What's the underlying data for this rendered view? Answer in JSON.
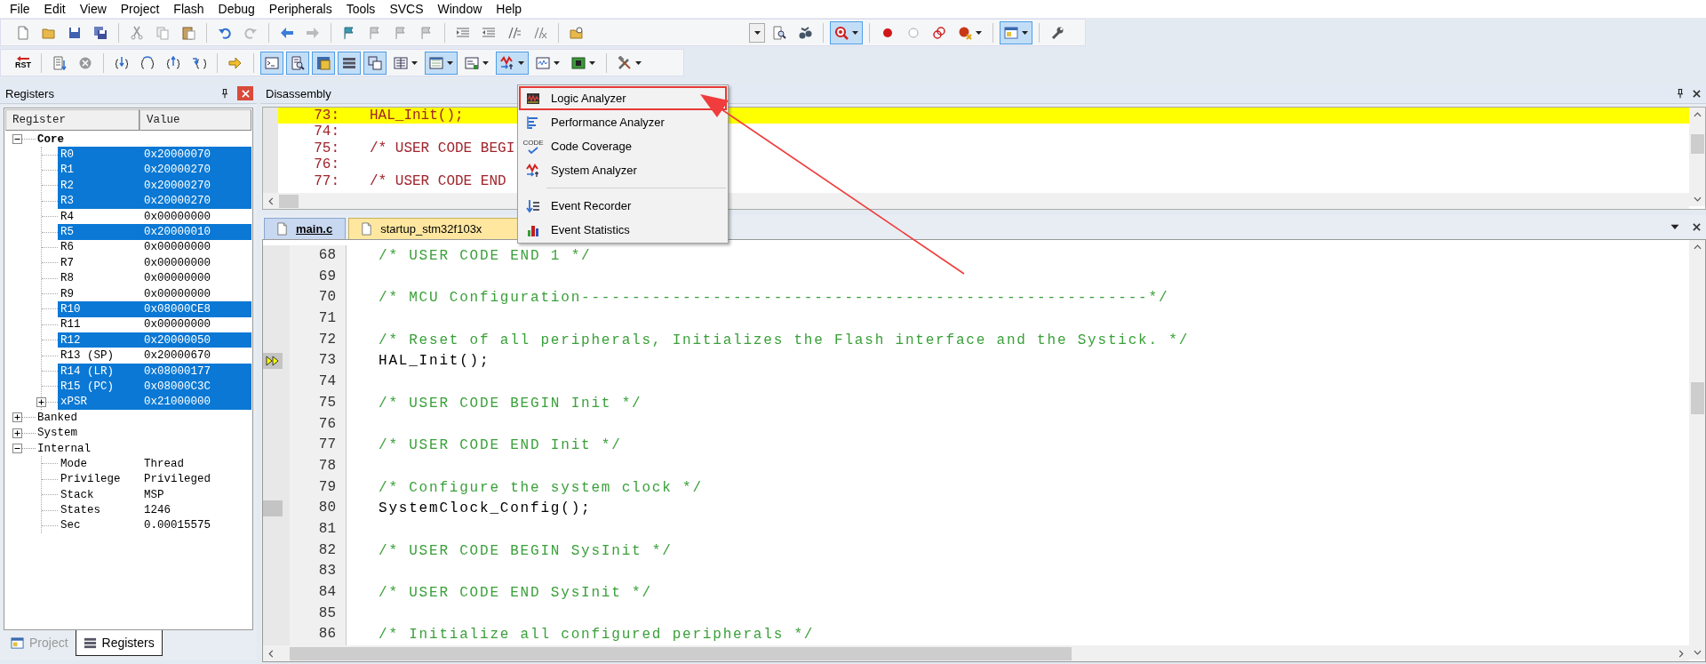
{
  "menu_bar": [
    "File",
    "Edit",
    "View",
    "Project",
    "Flash",
    "Debug",
    "Peripherals",
    "Tools",
    "SVCS",
    "Window",
    "Help"
  ],
  "toolbars": [
    {
      "items": [
        {
          "kind": "new",
          "pressed": false,
          "dropdown": false
        },
        {
          "kind": "open",
          "pressed": false,
          "dropdown": false
        },
        {
          "kind": "save",
          "pressed": false,
          "dropdown": false
        },
        {
          "kind": "saveall",
          "pressed": false,
          "dropdown": false
        },
        {
          "kind": "separator"
        },
        {
          "kind": "cut",
          "pressed": false,
          "dropdown": false
        },
        {
          "kind": "copy",
          "pressed": false,
          "dropdown": false
        },
        {
          "kind": "paste",
          "pressed": false,
          "dropdown": false
        },
        {
          "kind": "separator"
        },
        {
          "kind": "undo",
          "pressed": false,
          "dropdown": false
        },
        {
          "kind": "redo",
          "pressed": false,
          "dropdown": false
        },
        {
          "kind": "separator"
        },
        {
          "kind": "back",
          "pressed": false,
          "dropdown": false
        },
        {
          "kind": "forward",
          "pressed": false,
          "dropdown": false
        },
        {
          "kind": "separator"
        },
        {
          "kind": "flag",
          "pressed": false,
          "dropdown": false
        },
        {
          "kind": "flaggrey",
          "pressed": false,
          "dropdown": false
        },
        {
          "kind": "flaggrey",
          "pressed": false,
          "dropdown": false
        },
        {
          "kind": "flaggrey",
          "pressed": false,
          "dropdown": false
        },
        {
          "kind": "separator"
        },
        {
          "kind": "indent",
          "pressed": false,
          "dropdown": false
        },
        {
          "kind": "outdent",
          "pressed": false,
          "dropdown": false
        },
        {
          "kind": "comment",
          "pressed": false,
          "dropdown": false
        },
        {
          "kind": "uncomment",
          "pressed": false,
          "dropdown": false
        },
        {
          "kind": "separator"
        },
        {
          "kind": "findfolder",
          "pressed": false,
          "dropdown": false
        },
        {
          "kind": "combo",
          "pressed": false,
          "dropdown": true
        },
        {
          "kind": "finddoc",
          "pressed": false,
          "dropdown": false
        },
        {
          "kind": "bino",
          "pressed": false,
          "dropdown": false
        },
        {
          "kind": "separator"
        },
        {
          "kind": "debug",
          "pressed": true,
          "dropdown": true
        },
        {
          "kind": "separator"
        },
        {
          "kind": "bp",
          "pressed": false,
          "dropdown": false
        },
        {
          "kind": "bphollow",
          "pressed": false,
          "dropdown": false
        },
        {
          "kind": "bpdisable",
          "pressed": false,
          "dropdown": false
        },
        {
          "kind": "bpkill",
          "pressed": false,
          "dropdown": true
        },
        {
          "kind": "separator"
        },
        {
          "kind": "window",
          "pressed": true,
          "dropdown": true
        },
        {
          "kind": "separator"
        },
        {
          "kind": "wrench",
          "pressed": false,
          "dropdown": false
        }
      ]
    },
    {
      "items": [
        {
          "kind": "reset",
          "label": "RST",
          "pressed": false,
          "dropdown": false
        },
        {
          "kind": "separator"
        },
        {
          "kind": "regdoc",
          "pressed": false,
          "dropdown": false
        },
        {
          "kind": "stop",
          "pressed": false,
          "dropdown": false
        },
        {
          "kind": "separator"
        },
        {
          "kind": "stepin",
          "pressed": false,
          "dropdown": false
        },
        {
          "kind": "stepover",
          "pressed": false,
          "dropdown": false
        },
        {
          "kind": "stepout",
          "pressed": false,
          "dropdown": false
        },
        {
          "kind": "runto",
          "pressed": false,
          "dropdown": false
        },
        {
          "kind": "separator"
        },
        {
          "kind": "runarrow",
          "pressed": false,
          "dropdown": false
        },
        {
          "kind": "separator"
        },
        {
          "kind": "cmdwin",
          "pressed": true,
          "dropdown": false
        },
        {
          "kind": "disasm",
          "pressed": true,
          "dropdown": false
        },
        {
          "kind": "symbols",
          "pressed": true,
          "dropdown": false
        },
        {
          "kind": "registers",
          "pressed": true,
          "dropdown": false
        },
        {
          "kind": "callstack",
          "pressed": true,
          "dropdown": false
        },
        {
          "kind": "watch",
          "pressed": false,
          "dropdown": true
        },
        {
          "kind": "memory",
          "pressed": true,
          "dropdown": true
        },
        {
          "kind": "serial",
          "pressed": false,
          "dropdown": true
        },
        {
          "kind": "sysanalyzer",
          "pressed": true,
          "dropdown": true
        },
        {
          "kind": "trace",
          "pressed": false,
          "dropdown": true
        },
        {
          "kind": "toolbox",
          "pressed": false,
          "dropdown": true
        },
        {
          "kind": "separator"
        },
        {
          "kind": "tools",
          "pressed": false,
          "dropdown": true
        }
      ]
    }
  ],
  "registers": {
    "title": "Registers",
    "columns": [
      "Register",
      "Value"
    ],
    "groups": [
      {
        "label": "Core",
        "expanded": true,
        "children": [
          {
            "name": "R0",
            "value": "0x20000070",
            "selected": true
          },
          {
            "name": "R1",
            "value": "0x20000270",
            "selected": true
          },
          {
            "name": "R2",
            "value": "0x20000270",
            "selected": true
          },
          {
            "name": "R3",
            "value": "0x20000270",
            "selected": true
          },
          {
            "name": "R4",
            "value": "0x00000000",
            "selected": false
          },
          {
            "name": "R5",
            "value": "0x20000010",
            "selected": true
          },
          {
            "name": "R6",
            "value": "0x00000000",
            "selected": false
          },
          {
            "name": "R7",
            "value": "0x00000000",
            "selected": false
          },
          {
            "name": "R8",
            "value": "0x00000000",
            "selected": false
          },
          {
            "name": "R9",
            "value": "0x00000000",
            "selected": false
          },
          {
            "name": "R10",
            "value": "0x08000CE8",
            "selected": true
          },
          {
            "name": "R11",
            "value": "0x00000000",
            "selected": false
          },
          {
            "name": "R12",
            "value": "0x20000050",
            "selected": true
          },
          {
            "name": "R13 (SP)",
            "value": "0x20000670",
            "selected": false
          },
          {
            "name": "R14 (LR)",
            "value": "0x08000177",
            "selected": true
          },
          {
            "name": "R15 (PC)",
            "value": "0x08000C3C",
            "selected": true
          },
          {
            "name": "xPSR",
            "value": "0x21000000",
            "selected": true,
            "expanded": false
          }
        ]
      },
      {
        "label": "Banked",
        "expanded": false
      },
      {
        "label": "System",
        "expanded": false
      },
      {
        "label": "Internal",
        "expanded": true,
        "children": [
          {
            "name": "Mode",
            "value": "Thread",
            "selected": false
          },
          {
            "name": "Privilege",
            "value": "Privileged",
            "selected": false
          },
          {
            "name": "Stack",
            "value": "MSP",
            "selected": false
          },
          {
            "name": "States",
            "value": "1246",
            "selected": false
          },
          {
            "name": "Sec",
            "value": "0.00015575",
            "selected": false
          }
        ]
      }
    ]
  },
  "bottom_tabs": [
    {
      "label": "Project",
      "selected": false
    },
    {
      "label": "Registers",
      "selected": true
    }
  ],
  "disassembly": {
    "title": "Disassembly",
    "lines": [
      {
        "address": "73:",
        "code": "HAL_Init();",
        "current": true
      },
      {
        "address": "74:",
        "current": false
      },
      {
        "address": "75:",
        "code": "/* USER CODE BEGI",
        "current": false
      },
      {
        "address": "76:",
        "current": false
      },
      {
        "address": "77:",
        "code": "/* USER CODE END",
        "current": false
      }
    ]
  },
  "editor": {
    "tabs": [
      {
        "label": "main.c",
        "selected": true
      },
      {
        "label": "startup_stm32f103x",
        "selected": false
      }
    ],
    "lines": [
      {
        "number": "68",
        "kind": "comment",
        "code": "/* USER CODE END 1 */",
        "executable": false,
        "current": false
      },
      {
        "number": "69",
        "kind": "blank",
        "executable": false,
        "current": false
      },
      {
        "number": "70",
        "kind": "comment",
        "code": "/* MCU Configuration--------------------------------------------------------*/",
        "executable": false,
        "current": false
      },
      {
        "number": "71",
        "kind": "blank",
        "executable": false,
        "current": false
      },
      {
        "number": "72",
        "kind": "comment",
        "code": "/* Reset of all peripherals, Initializes the Flash interface and the Systick. */",
        "executable": false,
        "current": false
      },
      {
        "number": "73",
        "kind": "code",
        "code": "HAL_Init();",
        "executable": true,
        "current": true
      },
      {
        "number": "74",
        "kind": "blank",
        "executable": false,
        "current": false
      },
      {
        "number": "75",
        "kind": "comment",
        "code": "/* USER CODE BEGIN Init */",
        "executable": false,
        "current": false
      },
      {
        "number": "76",
        "kind": "blank",
        "executable": false,
        "current": false
      },
      {
        "number": "77",
        "kind": "comment",
        "code": "/* USER CODE END Init */",
        "executable": false,
        "current": false
      },
      {
        "number": "78",
        "kind": "blank",
        "executable": false,
        "current": false
      },
      {
        "number": "79",
        "kind": "comment",
        "code": "/* Configure the system clock */",
        "executable": false,
        "current": false
      },
      {
        "number": "80",
        "kind": "code",
        "code": "SystemClock_Config();",
        "executable": true,
        "current": false
      },
      {
        "number": "81",
        "kind": "blank",
        "executable": false,
        "current": false
      },
      {
        "number": "82",
        "kind": "comment",
        "code": "/* USER CODE BEGIN SysInit */",
        "executable": false,
        "current": false
      },
      {
        "number": "83",
        "kind": "blank",
        "executable": false,
        "current": false
      },
      {
        "number": "84",
        "kind": "comment",
        "code": "/* USER CODE END SysInit */",
        "executable": false,
        "current": false
      },
      {
        "number": "85",
        "kind": "blank",
        "executable": false,
        "current": false
      },
      {
        "number": "86",
        "kind": "comment",
        "code": "/* Initialize all configured peripherals */",
        "executable": false,
        "current": false
      }
    ]
  },
  "analysis_menu": {
    "items": [
      {
        "kind": "logic",
        "label": "Logic Analyzer",
        "outlined": true
      },
      {
        "kind": "performance",
        "label": "Performance Analyzer",
        "outlined": false
      },
      {
        "kind": "coverage",
        "label": "Code Coverage",
        "icon_text": "CODE",
        "outlined": false
      },
      {
        "kind": "system",
        "label": "System Analyzer",
        "outlined": false
      },
      {
        "kind": "separator"
      },
      {
        "kind": "recorder",
        "label": "Event Recorder",
        "outlined": false
      },
      {
        "kind": "statistics",
        "label": "Event Statistics",
        "outlined": false
      }
    ]
  },
  "annotation": {
    "kind": "arrow"
  }
}
